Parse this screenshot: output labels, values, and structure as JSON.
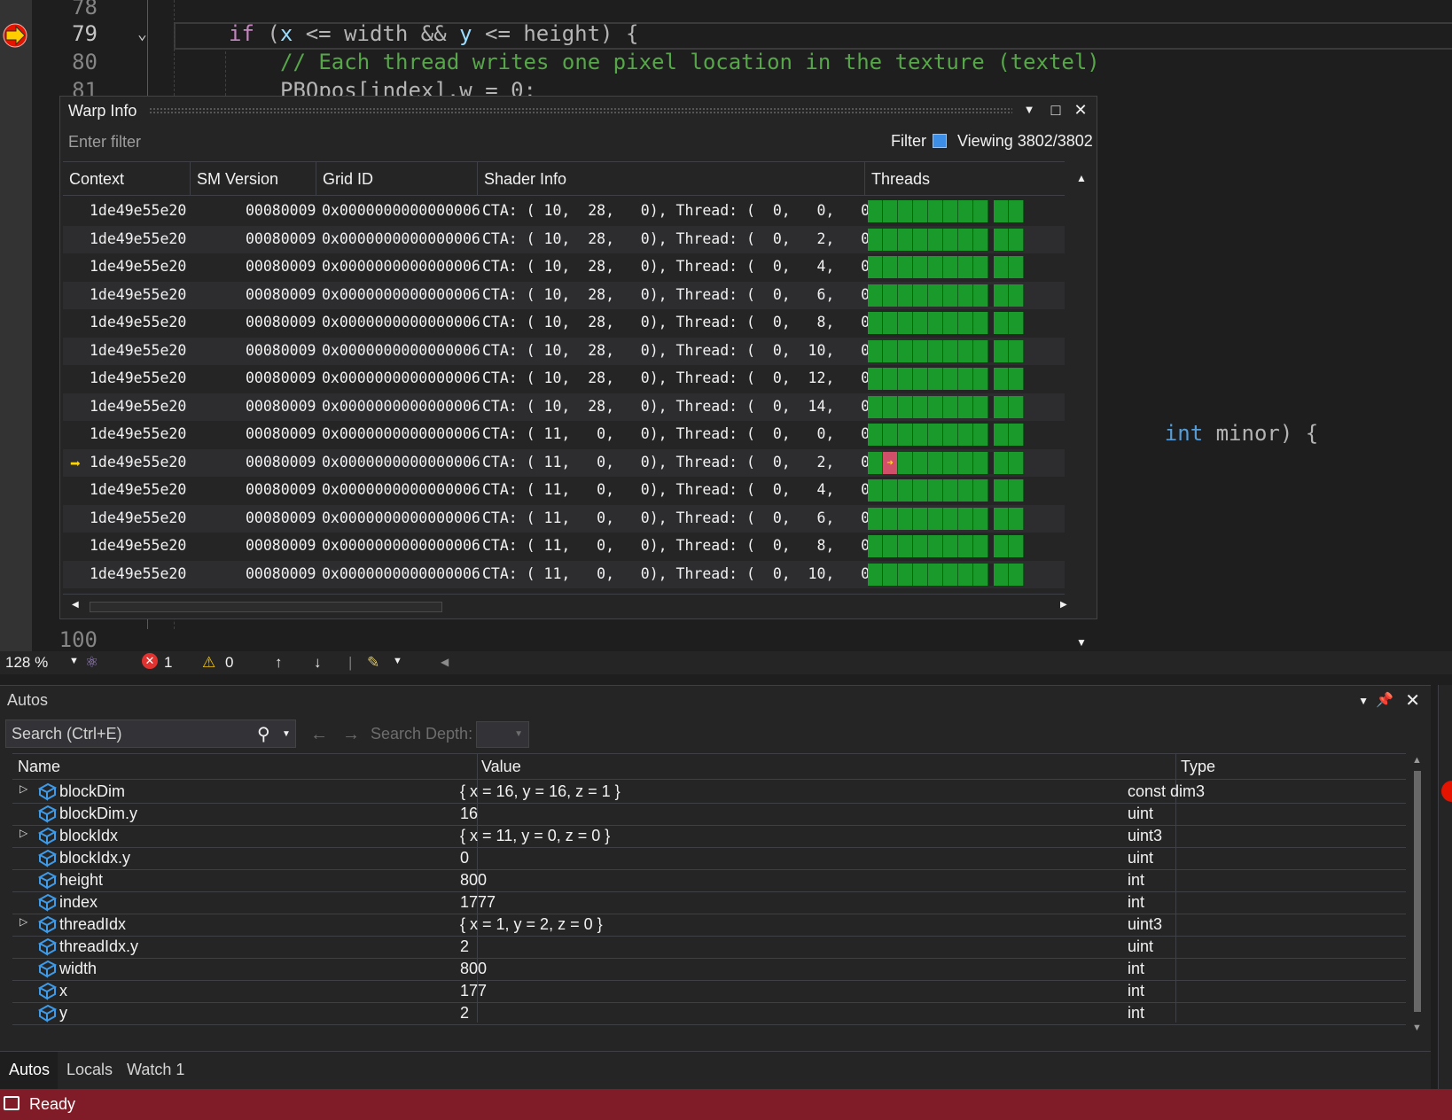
{
  "editor": {
    "lines": [
      {
        "num": "78",
        "text": ""
      },
      {
        "num": "79",
        "tokens": [
          [
            "kw",
            "if"
          ],
          [
            "op",
            " ("
          ],
          [
            "var",
            "x"
          ],
          [
            "op",
            " <= width && "
          ],
          [
            "var",
            "y"
          ],
          [
            "op",
            " <= height) {"
          ]
        ]
      },
      {
        "num": "80",
        "tokens": [
          [
            "cm",
            "// Each thread writes one pixel location in the texture (textel)"
          ]
        ]
      },
      {
        "num": "81",
        "tokens": [
          [
            "op",
            "PBOpos[index].w = 0;"
          ]
        ]
      }
    ],
    "partial_line_99_text": "int minor) {",
    "line_100": "100",
    "zoom": "128 %",
    "errors": "1",
    "warnings": "0"
  },
  "warp_info": {
    "title": "Warp Info",
    "filter_placeholder": "Enter filter",
    "filter_label": "Filter",
    "viewing": "Viewing 3802/3802",
    "columns": [
      "Context",
      "SM Version",
      "Grid ID",
      "Shader Info",
      "Threads"
    ],
    "rows": [
      {
        "context": "1de49e55e20",
        "sm": "00080009",
        "grid": "0x0000000000000006",
        "shader": "CTA: ( 10,  28,   0), Thread: (  0,   0,   0)",
        "current": false
      },
      {
        "context": "1de49e55e20",
        "sm": "00080009",
        "grid": "0x0000000000000006",
        "shader": "CTA: ( 10,  28,   0), Thread: (  0,   2,   0)",
        "current": false
      },
      {
        "context": "1de49e55e20",
        "sm": "00080009",
        "grid": "0x0000000000000006",
        "shader": "CTA: ( 10,  28,   0), Thread: (  0,   4,   0)",
        "current": false
      },
      {
        "context": "1de49e55e20",
        "sm": "00080009",
        "grid": "0x0000000000000006",
        "shader": "CTA: ( 10,  28,   0), Thread: (  0,   6,   0)",
        "current": false
      },
      {
        "context": "1de49e55e20",
        "sm": "00080009",
        "grid": "0x0000000000000006",
        "shader": "CTA: ( 10,  28,   0), Thread: (  0,   8,   0)",
        "current": false
      },
      {
        "context": "1de49e55e20",
        "sm": "00080009",
        "grid": "0x0000000000000006",
        "shader": "CTA: ( 10,  28,   0), Thread: (  0,  10,   0)",
        "current": false
      },
      {
        "context": "1de49e55e20",
        "sm": "00080009",
        "grid": "0x0000000000000006",
        "shader": "CTA: ( 10,  28,   0), Thread: (  0,  12,   0)",
        "current": false
      },
      {
        "context": "1de49e55e20",
        "sm": "00080009",
        "grid": "0x0000000000000006",
        "shader": "CTA: ( 10,  28,   0), Thread: (  0,  14,   0)",
        "current": false
      },
      {
        "context": "1de49e55e20",
        "sm": "00080009",
        "grid": "0x0000000000000006",
        "shader": "CTA: ( 11,   0,   0), Thread: (  0,   0,   0)",
        "current": false
      },
      {
        "context": "1de49e55e20",
        "sm": "00080009",
        "grid": "0x0000000000000006",
        "shader": "CTA: ( 11,   0,   0), Thread: (  0,   2,   0)",
        "current": true
      },
      {
        "context": "1de49e55e20",
        "sm": "00080009",
        "grid": "0x0000000000000006",
        "shader": "CTA: ( 11,   0,   0), Thread: (  0,   4,   0)",
        "current": false
      },
      {
        "context": "1de49e55e20",
        "sm": "00080009",
        "grid": "0x0000000000000006",
        "shader": "CTA: ( 11,   0,   0), Thread: (  0,   6,   0)",
        "current": false
      },
      {
        "context": "1de49e55e20",
        "sm": "00080009",
        "grid": "0x0000000000000006",
        "shader": "CTA: ( 11,   0,   0), Thread: (  0,   8,   0)",
        "current": false
      },
      {
        "context": "1de49e55e20",
        "sm": "00080009",
        "grid": "0x0000000000000006",
        "shader": "CTA: ( 11,   0,   0), Thread: (  0,  10,   0)",
        "current": false
      }
    ],
    "active_lane_color": "#1a9a2b",
    "current_lane_color": "#d24f6a"
  },
  "autos": {
    "title": "Autos",
    "search_placeholder": "Search (Ctrl+E)",
    "search_depth_label": "Search Depth:",
    "columns": [
      "Name",
      "Value",
      "Type"
    ],
    "rows": [
      {
        "name": "blockDim",
        "value": "{ x = 16, y = 16, z = 1 }",
        "type": "const dim3",
        "expandable": true
      },
      {
        "name": "blockDim.y",
        "value": "16",
        "type": "uint",
        "expandable": false
      },
      {
        "name": "blockIdx",
        "value": "{ x = 11, y = 0, z = 0 }",
        "type": "uint3",
        "expandable": true
      },
      {
        "name": "blockIdx.y",
        "value": "0",
        "type": "uint",
        "expandable": false
      },
      {
        "name": "height",
        "value": "800",
        "type": "int",
        "expandable": false
      },
      {
        "name": "index",
        "value": "1777",
        "type": "int",
        "expandable": false
      },
      {
        "name": "threadIdx",
        "value": "{ x = 1, y = 2, z = 0 }",
        "type": "uint3",
        "expandable": true
      },
      {
        "name": "threadIdx.y",
        "value": "2",
        "type": "uint",
        "expandable": false
      },
      {
        "name": "width",
        "value": "800",
        "type": "int",
        "expandable": false
      },
      {
        "name": "x",
        "value": "177",
        "type": "int",
        "expandable": false
      },
      {
        "name": "y",
        "value": "2",
        "type": "int",
        "expandable": false
      }
    ],
    "tabs": [
      "Autos",
      "Locals",
      "Watch 1"
    ],
    "active_tab": "Autos"
  },
  "status": {
    "text": "Ready",
    "bar_color": "#7f1c27"
  }
}
